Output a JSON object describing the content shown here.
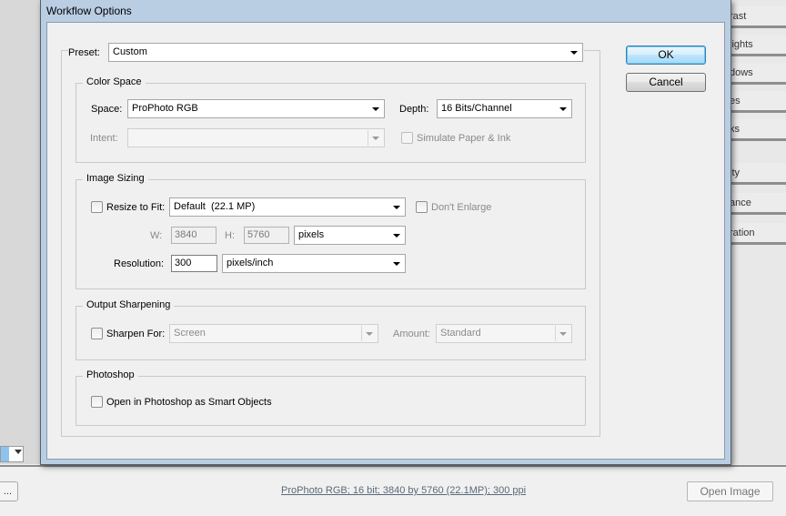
{
  "background": {
    "panel_items": [
      "rast",
      "lights",
      "dows",
      "es",
      "ks",
      "ity",
      "ance",
      "ration"
    ],
    "ellipsis_button": "...",
    "workflow_link": "ProPhoto RGB; 16 bit; 3840 by 5760 (22.1MP); 300 ppi",
    "open_image_button": "Open Image"
  },
  "dialog": {
    "title": "Workflow Options",
    "preset": {
      "label": "Preset:",
      "value": "Custom"
    },
    "ok_button": "OK",
    "cancel_button": "Cancel",
    "color_space": {
      "legend": "Color Space",
      "space_label": "Space:",
      "space_value": "ProPhoto RGB",
      "depth_label": "Depth:",
      "depth_value": "16 Bits/Channel",
      "intent_label": "Intent:",
      "intent_value": "",
      "simulate_label": "Simulate Paper & Ink"
    },
    "image_sizing": {
      "legend": "Image Sizing",
      "resize_label": "Resize to Fit:",
      "resize_value": "Default  (22.1 MP)",
      "dont_enlarge_label": "Don't Enlarge",
      "w_label": "W:",
      "w_value": "3840",
      "h_label": "H:",
      "h_value": "5760",
      "units_value": "pixels",
      "resolution_label": "Resolution:",
      "resolution_value": "300",
      "resolution_units": "pixels/inch"
    },
    "output_sharpening": {
      "legend": "Output Sharpening",
      "sharpen_label": "Sharpen For:",
      "sharpen_value": "Screen",
      "amount_label": "Amount:",
      "amount_value": "Standard"
    },
    "photoshop": {
      "legend": "Photoshop",
      "smart_objects_label": "Open in Photoshop as Smart Objects"
    }
  }
}
